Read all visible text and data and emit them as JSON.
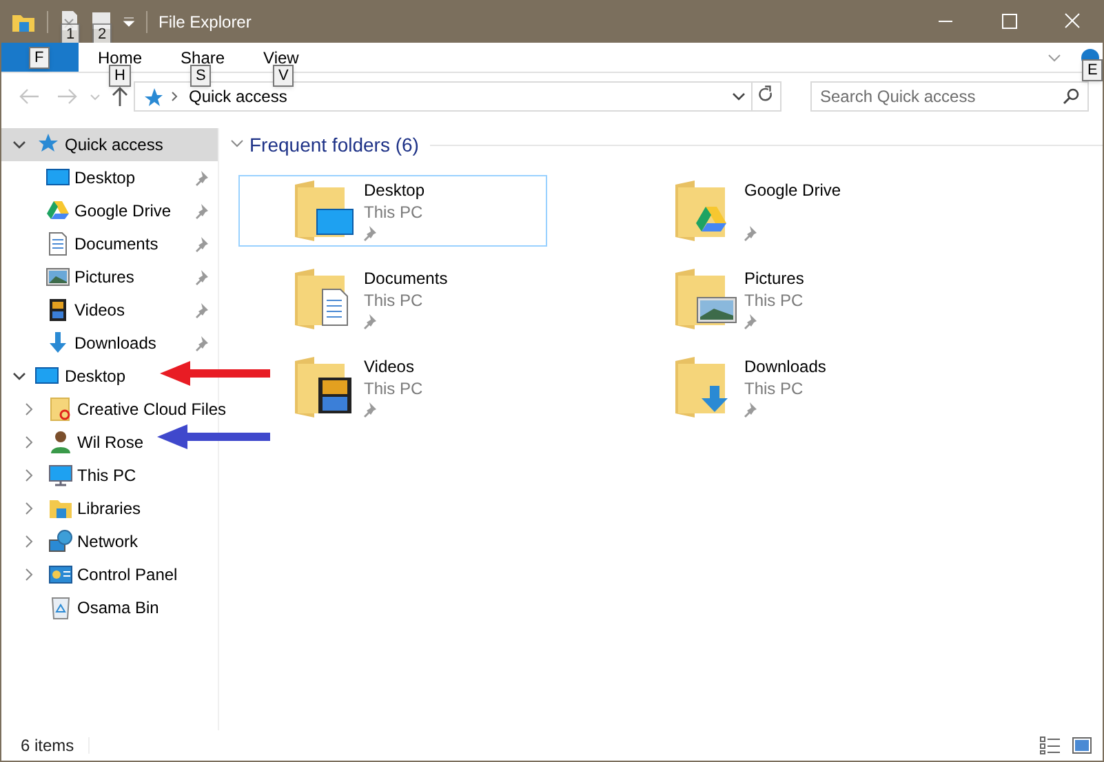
{
  "window": {
    "title": "File Explorer",
    "quick_access_toolbar": [
      {
        "key_tip": "1"
      },
      {
        "key_tip": "2"
      }
    ]
  },
  "ribbon": {
    "file_tab": {
      "key_tip": "F"
    },
    "tabs": [
      {
        "label": "Home",
        "key_tip": "H",
        "selected": false
      },
      {
        "label": "Share",
        "key_tip": "S",
        "selected": false
      },
      {
        "label": "View",
        "key_tip": "V",
        "selected": false
      }
    ],
    "help_key_tip": "E"
  },
  "address_bar": {
    "path": "Quick access"
  },
  "search": {
    "placeholder": "Search Quick access"
  },
  "navigation": [
    {
      "label": "Quick access",
      "expanded": true,
      "selected": true,
      "children": [
        {
          "label": "Desktop",
          "pinned": true
        },
        {
          "label": "Google Drive",
          "pinned": true
        },
        {
          "label": "Documents",
          "pinned": true
        },
        {
          "label": "Pictures",
          "pinned": true
        },
        {
          "label": "Videos",
          "pinned": true
        },
        {
          "label": "Downloads",
          "pinned": true
        }
      ]
    },
    {
      "label": "Desktop",
      "expanded": true,
      "selected": false,
      "children": [
        {
          "label": "Creative Cloud Files",
          "expander": true
        },
        {
          "label": "Wil Rose",
          "expander": true
        },
        {
          "label": "This PC",
          "expander": true
        },
        {
          "label": "Libraries",
          "expander": true
        },
        {
          "label": "Network",
          "expander": true
        },
        {
          "label": "Control Panel",
          "expander": true
        },
        {
          "label": "Osama Bin",
          "expander": false
        }
      ]
    }
  ],
  "section": {
    "title": "Frequent folders (6)",
    "expanded": true
  },
  "folders": [
    {
      "name": "Desktop",
      "location": "This PC",
      "selected": true
    },
    {
      "name": "Google Drive",
      "selected": false
    },
    {
      "name": "Documents",
      "location": "This PC",
      "selected": false
    },
    {
      "name": "Pictures",
      "location": "This PC",
      "selected": false
    },
    {
      "name": "Videos",
      "location": "This PC",
      "selected": false
    },
    {
      "name": "Downloads",
      "location": "This PC",
      "selected": false
    }
  ],
  "annotations": [
    {
      "color": "#e81c24"
    },
    {
      "color": "#3f48cc"
    }
  ],
  "status_bar": {
    "text": "6 items"
  }
}
